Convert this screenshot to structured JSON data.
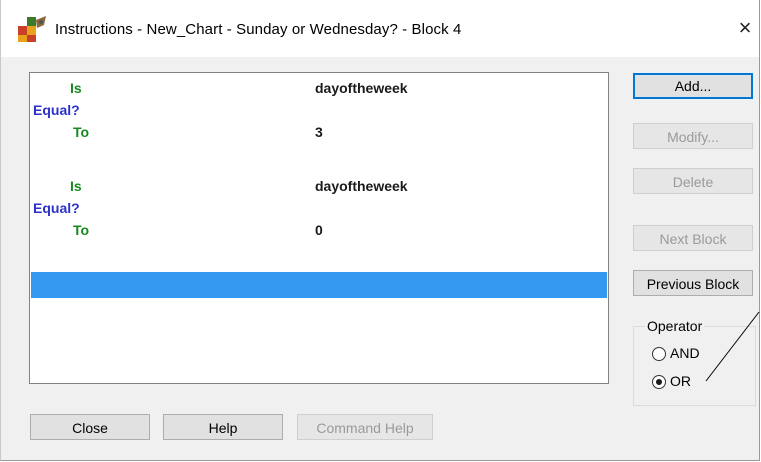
{
  "window": {
    "title": "Instructions - New_Chart - Sunday or Wednesday? - Block 4",
    "close_glyph": "×",
    "icon": "app-puzzle-icon"
  },
  "instructions": {
    "rows": [
      {
        "keyword": "Is",
        "value": "dayoftheweek"
      },
      {
        "keyword": "Equal?"
      },
      {
        "keyword": "To",
        "value": "3"
      },
      {
        "keyword": "Is",
        "value": "dayoftheweek"
      },
      {
        "keyword": "Equal?"
      },
      {
        "keyword": "To",
        "value": "0"
      }
    ],
    "selected_row": "empty"
  },
  "side_buttons": {
    "add": "Add...",
    "modify": "Modify...",
    "delete": "Delete",
    "next_block": "Next Block",
    "previous_block": "Previous Block"
  },
  "operator": {
    "label": "Operator",
    "options": [
      "AND",
      "OR"
    ],
    "selected": "OR"
  },
  "bottom_buttons": {
    "close": "Close",
    "help": "Help",
    "command_help": "Command Help"
  },
  "colors": {
    "keyword_green": "#168a1f",
    "keyword_blue": "#2b31c9",
    "selection": "#3399f0",
    "default_button_border": "#0078d7"
  }
}
